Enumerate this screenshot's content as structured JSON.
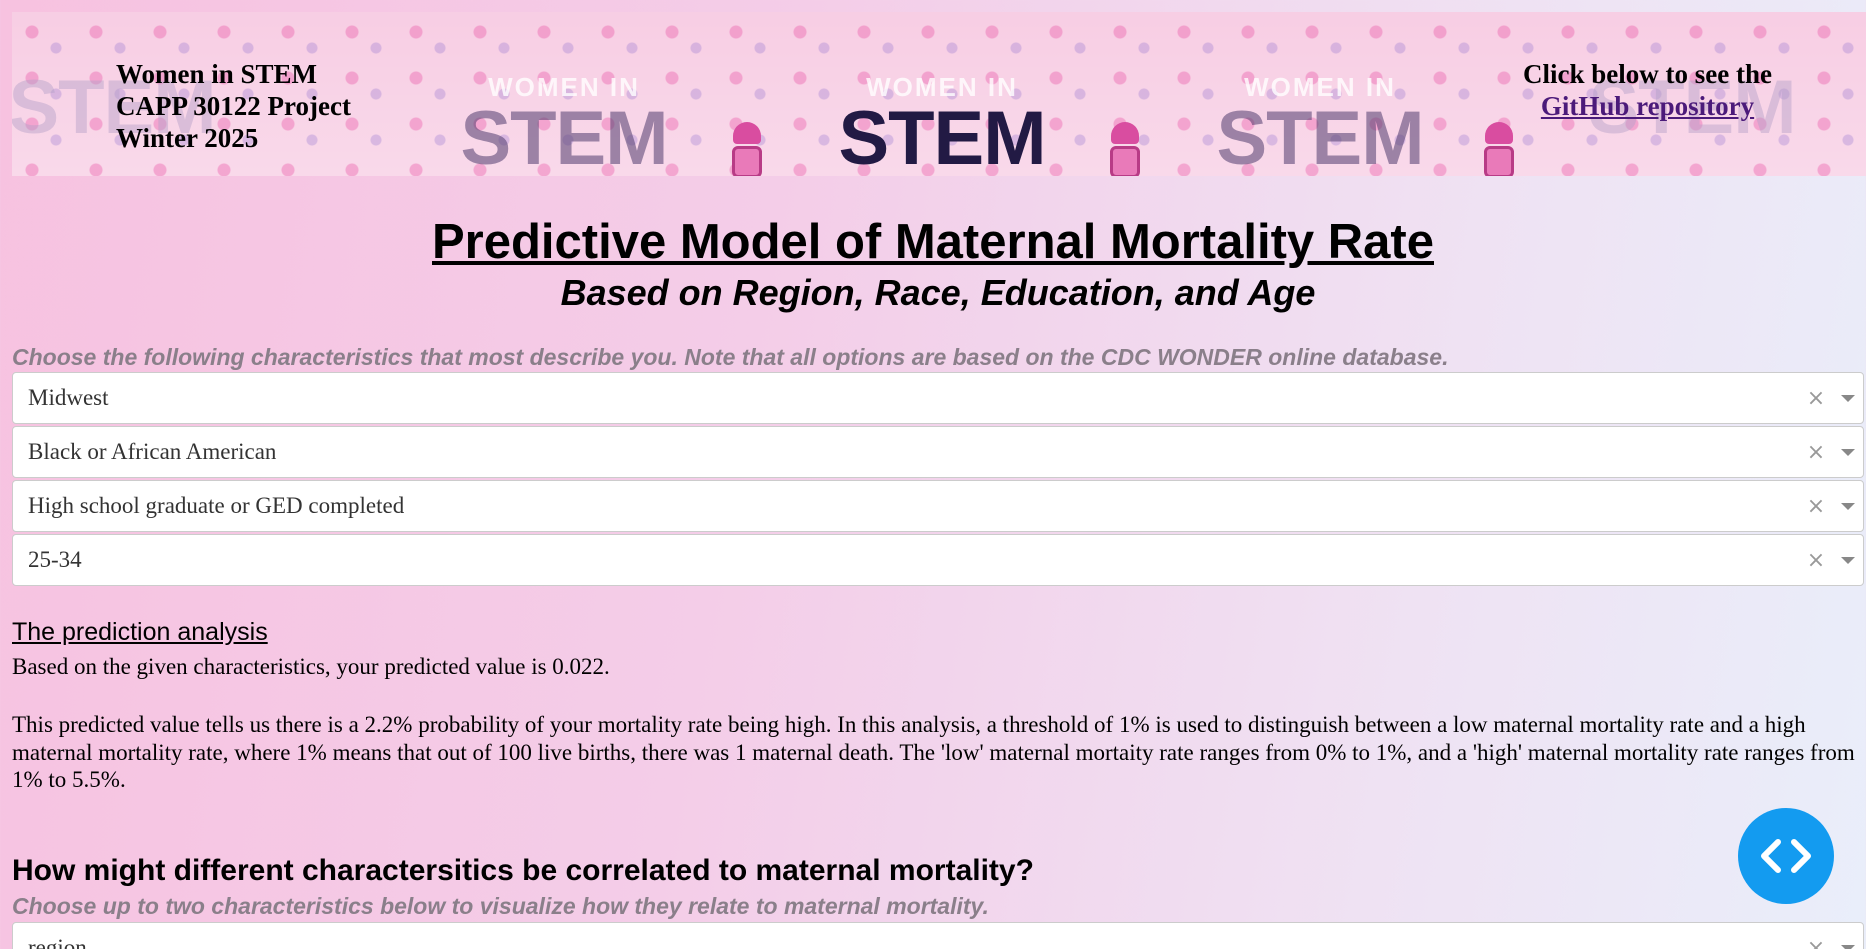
{
  "banner": {
    "left_lines": [
      "Women in STEM",
      "CAPP 30122 Project",
      "Winter 2025"
    ],
    "right_line": "Click below to see the",
    "github_link": "GitHub repository",
    "banner_small_word": "WOMEN IN",
    "banner_big_word": "STEM"
  },
  "title": "Predictive Model of Maternal Mortality Rate",
  "subtitle": "Based on Region, Race, Education, and Age",
  "instructions": "Choose the following characteristics that most describe you. Note that all options are based on the CDC WONDER online database.",
  "dropdowns": [
    {
      "value": "Midwest",
      "clear": "×"
    },
    {
      "value": "Black or African American",
      "clear": "×"
    },
    {
      "value": "High school graduate or GED completed",
      "clear": "×"
    },
    {
      "value": "25-34",
      "clear": "×"
    }
  ],
  "analysis": {
    "heading": "The prediction analysis",
    "predicted": "Based on the given characteristics, your predicted value is 0.022.",
    "explanation": "This predicted value tells us there is a 2.2% probability of your mortality rate being high. In this analysis, a threshold of 1% is used to distinguish between a low maternal mortality rate and a high maternal mortality rate, where 1% means that out of 100 live births, there was 1 maternal death. The 'low' maternal mortaity rate ranges from 0% to 1%, and a 'high' maternal mortality rate ranges from 1% to 5.5%."
  },
  "correlation": {
    "heading": "How might different charactersitics be correlated to maternal mortality?",
    "instructions": "Choose up to two characteristics below to visualize how they relate to maternal mortality.",
    "dropdown": {
      "value": "region",
      "clear": "×"
    }
  },
  "fab": {
    "icon": "code-brackets-icon"
  },
  "colors": {
    "link": "#4b1a7a",
    "fab": "#139bf0",
    "instruction_text": "#8a7f8a"
  }
}
